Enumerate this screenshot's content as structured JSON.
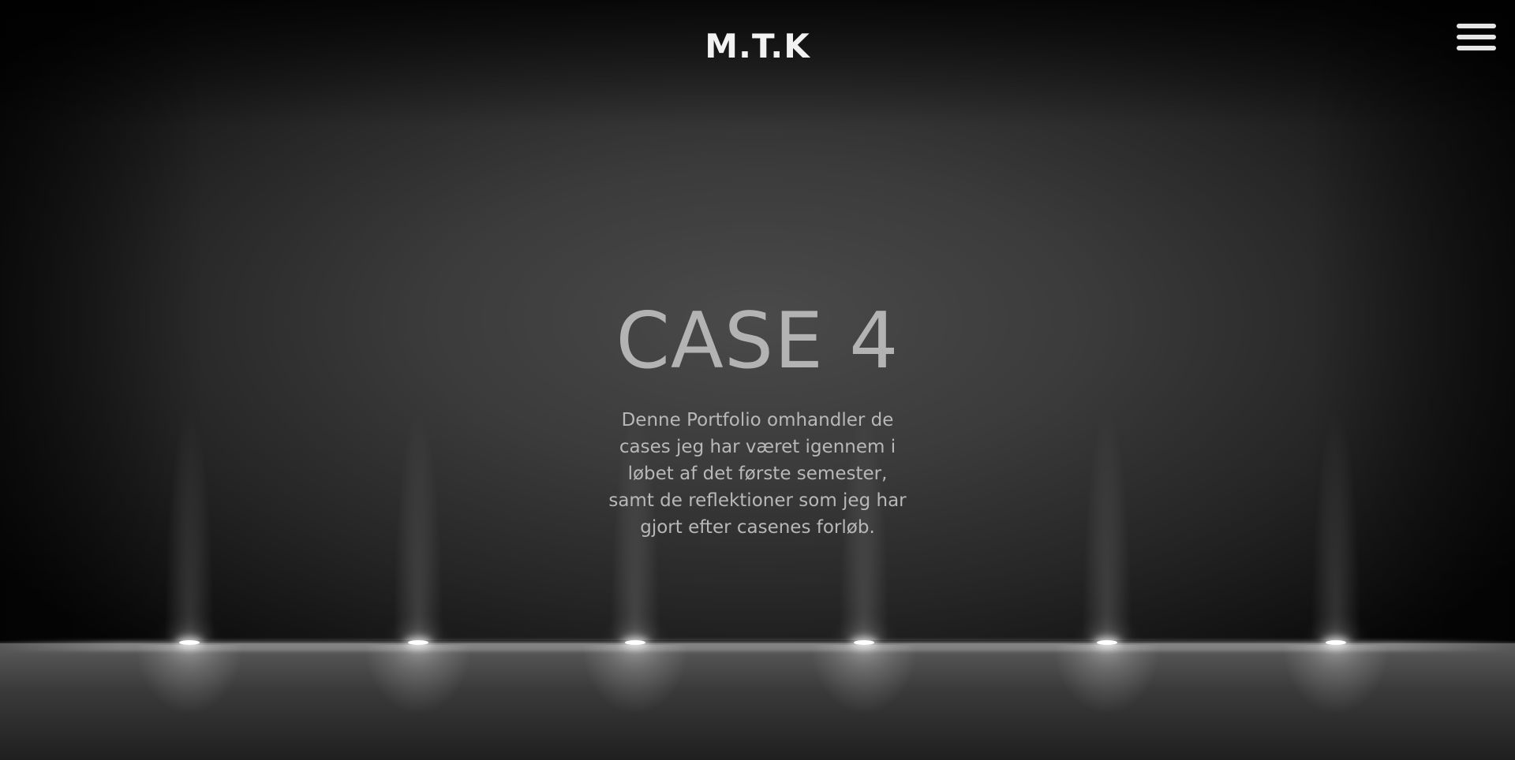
{
  "header": {
    "logo_text": "M.T.K",
    "menu_icon": "hamburger-menu-icon"
  },
  "hero": {
    "title": "CASE 4",
    "description": "Denne Portfolio omhandler de cases jeg har været igennem i løbet af det første semester, samt de reflektioner som jeg har gjort efter casenes forløb."
  },
  "colors": {
    "background": "#3b3b3b",
    "title": "#b3b3b3",
    "text": "#b8b8b8",
    "logo": "#f2f2f2"
  }
}
